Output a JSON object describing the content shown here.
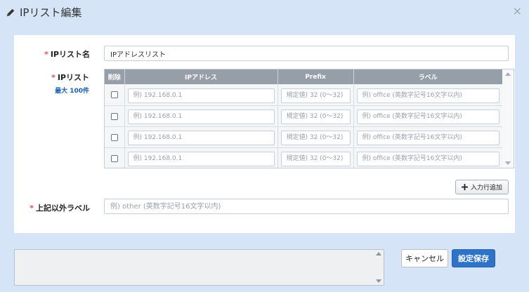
{
  "dialog": {
    "title": "IPリスト編集",
    "close_symbol": "×"
  },
  "form": {
    "required_mark": "*",
    "name_label": "IPリスト名",
    "name_value": "IPアドレスリスト",
    "list_label": "IPリスト",
    "list_sublabel": "最大 100件",
    "other_label": "上記以外ラベル",
    "other_placeholder": "例) other (英数字記号16文字以内)"
  },
  "table": {
    "headers": [
      "削除",
      "IPアドレス",
      "Prefix",
      "ラベル"
    ],
    "rows": [
      {
        "ip_placeholder": "例) 192.168.0.1",
        "prefix_placeholder": "規定値) 32 (0～32)",
        "label_placeholder": "例) office (英数字記号16文字以内)"
      },
      {
        "ip_placeholder": "例) 192.168.0.1",
        "prefix_placeholder": "規定値) 32 (0～32)",
        "label_placeholder": "例) office (英数字記号16文字以内)"
      },
      {
        "ip_placeholder": "例) 192.168.0.1",
        "prefix_placeholder": "規定値) 32 (0～32)",
        "label_placeholder": "例) office (英数字記号16文字以内)"
      },
      {
        "ip_placeholder": "例) 192.168.0.1",
        "prefix_placeholder": "規定値) 32 (0～32)",
        "label_placeholder": "例) office (英数字記号16文字以内)"
      }
    ],
    "add_row_label": "入力行追加"
  },
  "footer": {
    "cancel_label": "キャンセル",
    "save_label": "設定保存"
  },
  "colors": {
    "background": "#d6e4f7",
    "header_gray": "#969ea8",
    "primary_blue": "#2f73c9",
    "required_red": "#d9534f"
  }
}
